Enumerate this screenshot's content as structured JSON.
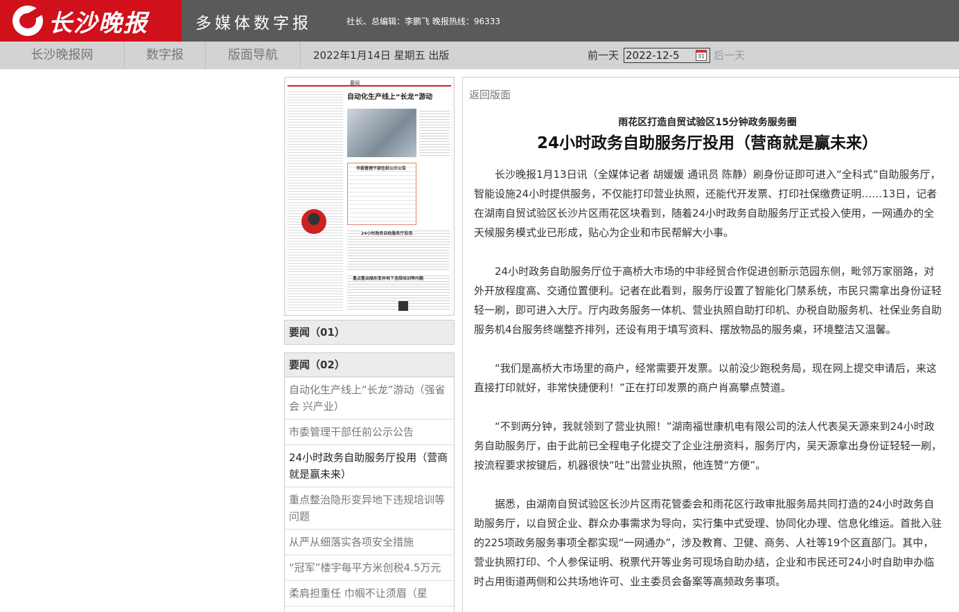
{
  "header": {
    "logo_text": "长沙晚报",
    "site_title": "多媒体数字报",
    "sub_info": "社长、总编辑：李鹏飞 晚报热线：96333"
  },
  "nav": {
    "items": [
      "长沙晚报网",
      "数字报",
      "版面导航"
    ],
    "issue_date": "2022年1月14日 星期五 出版",
    "prev_day": "前一天",
    "date_value": "2022-12-5",
    "calendar_day": "31",
    "next_day": "后一天"
  },
  "thumbnail": {
    "page_label": "要闻",
    "headline": "自动化生产线上“长龙”游动",
    "table_title": "市委管理干部任前公示公告",
    "mid_headline": "24小时政务自助服务厅投用",
    "bottom_headline": "重点整治隐形变异地下违规培训等问题"
  },
  "sections": [
    {
      "label": "要闻（01）"
    },
    {
      "label": "要闻（02）"
    }
  ],
  "articles": [
    "自动化生产线上“长龙”游动（强省会 兴产业）",
    "市委管理干部任前公示公告",
    "24小时政务自助服务厅投用（营商就是赢未来）",
    "重点整治隐形变异地下违规培训等问题",
    "从严从细落实各项安全措施",
    "“冠军”楼宇每平方米创税4.5万元",
    "柔肩担重任 巾帼不让须眉（星"
  ],
  "article": {
    "back": "返回版面",
    "subtitle": "雨花区打造自贸试验区15分钟政务服务圈",
    "title": "24小时政务自助服务厅投用（营商就是赢未来）",
    "paragraphs": [
      "长沙晚报1月13日讯（全媒体记者 胡媛媛 通讯员 陈静）刷身份证即可进入“全科式”自助服务厅，智能设施24小时提供服务，不仅能打印营业执照，还能代开发票、打印社保缴费证明……13日，记者在湖南自贸试验区长沙片区雨花区块看到，随着24小时政务自助服务厅正式投入使用，一网通办的全天候服务模式业已形成，贴心为企业和市民帮解大小事。",
      "24小时政务自助服务厅位于高桥大市场的中非经贸合作促进创新示范园东侧，毗邻万家丽路，对外开放程度高、交通位置便利。记者在此看到，服务厅设置了智能化门禁系统，市民只需拿出身份证轻轻一刷，即可进入大厅。厅内政务服务一体机、营业执照自助打印机、办税自助服务机、社保业务自助服务机4台服务终端整齐排列，还设有用于填写资料、摆放物品的服务桌，环境整洁又温馨。",
      "“我们是高桥大市场里的商户，经常需要开发票。以前没少跑税务局，现在网上提交申请后，来这直接打印就好，非常快捷便利！”正在打印发票的商户肖高攀点赞道。",
      "“不到两分钟，我就领到了营业执照！”湖南福世康机电有限公司的法人代表吴天源来到24小时政务自助服务厅，由于此前已全程电子化提交了企业注册资料，服务厅内，吴天源拿出身份证轻轻一刷，按流程要求按键后，机器很快“吐”出营业执照，他连赞“方便”。",
      "据悉，由湖南自贸试验区长沙片区雨花管委会和雨花区行政审批服务局共同打造的24小时政务自助服务厅，以自贸企业、群众办事需求为导向，实行集中式受理、协同化办理、信息化维运。首批入驻的225项政务服务事项全都实现“一网通办”，涉及教育、卫健、商务、人社等19个区直部门。其中，营业执照打印、个人参保证明、税票代开等业务可现场自助办结，企业和市民还可24小时自助申办临时占用街道两侧和公共场地许可、业主委员会备案等高频政务事项。"
    ]
  }
}
